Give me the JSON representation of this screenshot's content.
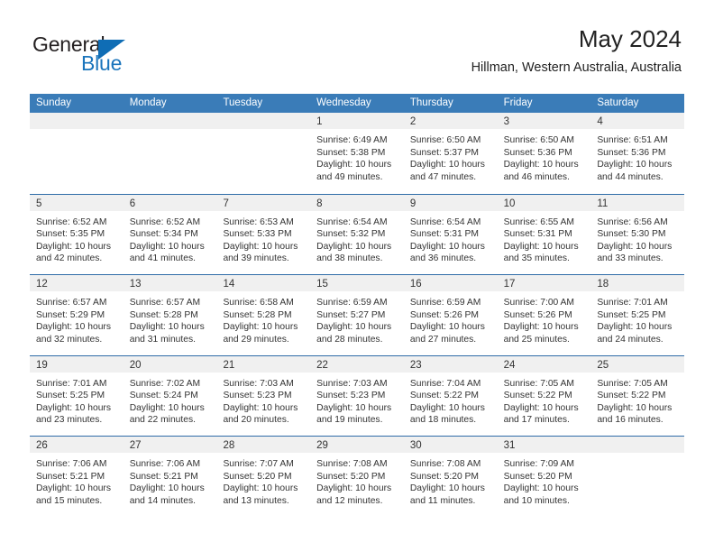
{
  "brand": {
    "name_top": "General",
    "name_bottom": "Blue",
    "accent_color": "#0f6db5",
    "dark_color": "#231f20"
  },
  "header": {
    "title": "May 2024",
    "subtitle": "Hillman, Western Australia, Australia"
  },
  "theme": {
    "header_row_bg": "#3a7cb8",
    "week_divider": "#2f6ca8",
    "daynum_band_bg": "#f0f0f0",
    "text_color": "#333333"
  },
  "weekdays": [
    "Sunday",
    "Monday",
    "Tuesday",
    "Wednesday",
    "Thursday",
    "Friday",
    "Saturday"
  ],
  "weeks": [
    [
      {
        "day": "",
        "lines": []
      },
      {
        "day": "",
        "lines": []
      },
      {
        "day": "",
        "lines": []
      },
      {
        "day": "1",
        "lines": [
          "Sunrise: 6:49 AM",
          "Sunset: 5:38 PM",
          "Daylight: 10 hours",
          "and 49 minutes."
        ]
      },
      {
        "day": "2",
        "lines": [
          "Sunrise: 6:50 AM",
          "Sunset: 5:37 PM",
          "Daylight: 10 hours",
          "and 47 minutes."
        ]
      },
      {
        "day": "3",
        "lines": [
          "Sunrise: 6:50 AM",
          "Sunset: 5:36 PM",
          "Daylight: 10 hours",
          "and 46 minutes."
        ]
      },
      {
        "day": "4",
        "lines": [
          "Sunrise: 6:51 AM",
          "Sunset: 5:36 PM",
          "Daylight: 10 hours",
          "and 44 minutes."
        ]
      }
    ],
    [
      {
        "day": "5",
        "lines": [
          "Sunrise: 6:52 AM",
          "Sunset: 5:35 PM",
          "Daylight: 10 hours",
          "and 42 minutes."
        ]
      },
      {
        "day": "6",
        "lines": [
          "Sunrise: 6:52 AM",
          "Sunset: 5:34 PM",
          "Daylight: 10 hours",
          "and 41 minutes."
        ]
      },
      {
        "day": "7",
        "lines": [
          "Sunrise: 6:53 AM",
          "Sunset: 5:33 PM",
          "Daylight: 10 hours",
          "and 39 minutes."
        ]
      },
      {
        "day": "8",
        "lines": [
          "Sunrise: 6:54 AM",
          "Sunset: 5:32 PM",
          "Daylight: 10 hours",
          "and 38 minutes."
        ]
      },
      {
        "day": "9",
        "lines": [
          "Sunrise: 6:54 AM",
          "Sunset: 5:31 PM",
          "Daylight: 10 hours",
          "and 36 minutes."
        ]
      },
      {
        "day": "10",
        "lines": [
          "Sunrise: 6:55 AM",
          "Sunset: 5:31 PM",
          "Daylight: 10 hours",
          "and 35 minutes."
        ]
      },
      {
        "day": "11",
        "lines": [
          "Sunrise: 6:56 AM",
          "Sunset: 5:30 PM",
          "Daylight: 10 hours",
          "and 33 minutes."
        ]
      }
    ],
    [
      {
        "day": "12",
        "lines": [
          "Sunrise: 6:57 AM",
          "Sunset: 5:29 PM",
          "Daylight: 10 hours",
          "and 32 minutes."
        ]
      },
      {
        "day": "13",
        "lines": [
          "Sunrise: 6:57 AM",
          "Sunset: 5:28 PM",
          "Daylight: 10 hours",
          "and 31 minutes."
        ]
      },
      {
        "day": "14",
        "lines": [
          "Sunrise: 6:58 AM",
          "Sunset: 5:28 PM",
          "Daylight: 10 hours",
          "and 29 minutes."
        ]
      },
      {
        "day": "15",
        "lines": [
          "Sunrise: 6:59 AM",
          "Sunset: 5:27 PM",
          "Daylight: 10 hours",
          "and 28 minutes."
        ]
      },
      {
        "day": "16",
        "lines": [
          "Sunrise: 6:59 AM",
          "Sunset: 5:26 PM",
          "Daylight: 10 hours",
          "and 27 minutes."
        ]
      },
      {
        "day": "17",
        "lines": [
          "Sunrise: 7:00 AM",
          "Sunset: 5:26 PM",
          "Daylight: 10 hours",
          "and 25 minutes."
        ]
      },
      {
        "day": "18",
        "lines": [
          "Sunrise: 7:01 AM",
          "Sunset: 5:25 PM",
          "Daylight: 10 hours",
          "and 24 minutes."
        ]
      }
    ],
    [
      {
        "day": "19",
        "lines": [
          "Sunrise: 7:01 AM",
          "Sunset: 5:25 PM",
          "Daylight: 10 hours",
          "and 23 minutes."
        ]
      },
      {
        "day": "20",
        "lines": [
          "Sunrise: 7:02 AM",
          "Sunset: 5:24 PM",
          "Daylight: 10 hours",
          "and 22 minutes."
        ]
      },
      {
        "day": "21",
        "lines": [
          "Sunrise: 7:03 AM",
          "Sunset: 5:23 PM",
          "Daylight: 10 hours",
          "and 20 minutes."
        ]
      },
      {
        "day": "22",
        "lines": [
          "Sunrise: 7:03 AM",
          "Sunset: 5:23 PM",
          "Daylight: 10 hours",
          "and 19 minutes."
        ]
      },
      {
        "day": "23",
        "lines": [
          "Sunrise: 7:04 AM",
          "Sunset: 5:22 PM",
          "Daylight: 10 hours",
          "and 18 minutes."
        ]
      },
      {
        "day": "24",
        "lines": [
          "Sunrise: 7:05 AM",
          "Sunset: 5:22 PM",
          "Daylight: 10 hours",
          "and 17 minutes."
        ]
      },
      {
        "day": "25",
        "lines": [
          "Sunrise: 7:05 AM",
          "Sunset: 5:22 PM",
          "Daylight: 10 hours",
          "and 16 minutes."
        ]
      }
    ],
    [
      {
        "day": "26",
        "lines": [
          "Sunrise: 7:06 AM",
          "Sunset: 5:21 PM",
          "Daylight: 10 hours",
          "and 15 minutes."
        ]
      },
      {
        "day": "27",
        "lines": [
          "Sunrise: 7:06 AM",
          "Sunset: 5:21 PM",
          "Daylight: 10 hours",
          "and 14 minutes."
        ]
      },
      {
        "day": "28",
        "lines": [
          "Sunrise: 7:07 AM",
          "Sunset: 5:20 PM",
          "Daylight: 10 hours",
          "and 13 minutes."
        ]
      },
      {
        "day": "29",
        "lines": [
          "Sunrise: 7:08 AM",
          "Sunset: 5:20 PM",
          "Daylight: 10 hours",
          "and 12 minutes."
        ]
      },
      {
        "day": "30",
        "lines": [
          "Sunrise: 7:08 AM",
          "Sunset: 5:20 PM",
          "Daylight: 10 hours",
          "and 11 minutes."
        ]
      },
      {
        "day": "31",
        "lines": [
          "Sunrise: 7:09 AM",
          "Sunset: 5:20 PM",
          "Daylight: 10 hours",
          "and 10 minutes."
        ]
      },
      {
        "day": "",
        "lines": []
      }
    ]
  ]
}
